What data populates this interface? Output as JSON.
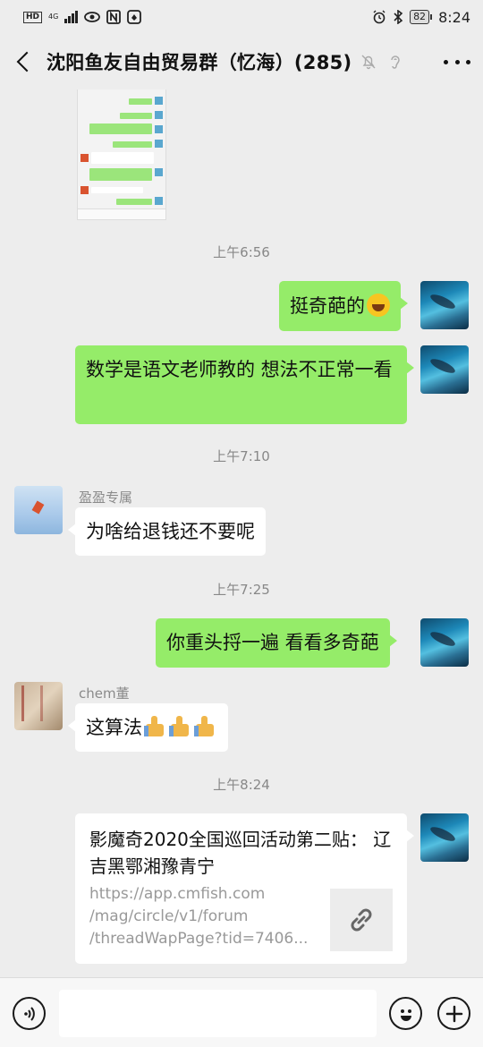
{
  "status_bar": {
    "hd": "HD",
    "network": "4G",
    "battery": "82",
    "time": "8:24"
  },
  "header": {
    "title": "沈阳鱼友自由贸易群（忆海）(285)"
  },
  "messages": {
    "time_1": "上午6:56",
    "msg_1": "挺奇葩的",
    "msg_2": "数学是语文老师教的 想法不正常一看",
    "time_2": "上午7:10",
    "sender_1": "盈盈专属",
    "msg_3": "为啥给退钱还不要呢",
    "time_3": "上午7:25",
    "msg_4": "你重头捋一遍 看看多奇葩",
    "sender_2": "chem董",
    "msg_5": "这算法",
    "time_4": "上午8:24"
  },
  "link_card": {
    "title": "影魔奇2020全国巡回活动第二贴： 辽吉黑鄂湘豫青宁",
    "url_line_1": "https://app.cmfish.com",
    "url_line_2": "/mag/circle/v1/forum",
    "url_line_3": "/threadWapPage?tid=7406..."
  },
  "icons": {
    "back": "back-arrow-icon",
    "mute": "mute-bell-icon",
    "ear": "earpiece-icon",
    "more": "more-dots-icon",
    "voice": "voice-icon",
    "emoji": "emoji-icon",
    "plus": "plus-icon",
    "link": "link-icon"
  },
  "colors": {
    "self_bubble": "#95ec69",
    "other_bubble": "#ffffff",
    "background": "#ededed"
  }
}
